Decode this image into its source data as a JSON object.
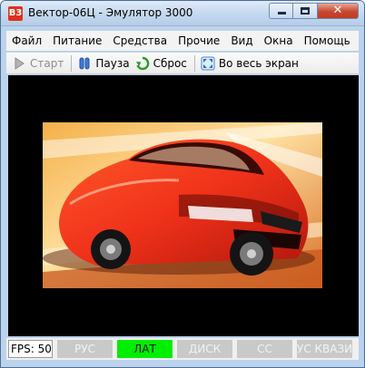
{
  "window": {
    "title": "Вектор-06Ц - Эмулятор 3000",
    "icon_glyph": "B3",
    "close_glyph": "✕"
  },
  "menu": [
    {
      "label": "Файл"
    },
    {
      "label": "Питание"
    },
    {
      "label": "Средства"
    },
    {
      "label": "Прочие"
    },
    {
      "label": "Вид"
    },
    {
      "label": "Окна"
    },
    {
      "label": "Помощь"
    }
  ],
  "toolbar": {
    "start_label": "Старт",
    "start_enabled": false,
    "pause_label": "Пауза",
    "reset_label": "Сброс",
    "fullscreen_label": "Во весь экран"
  },
  "screen": {
    "content": "red-sports-car-image"
  },
  "status": {
    "fps_text": "FPS: 50",
    "indicators": [
      {
        "label": "РУС",
        "active": false
      },
      {
        "label": "ЛАТ",
        "active": true
      },
      {
        "label": "ДИСК",
        "active": false
      },
      {
        "label": "СС",
        "active": false
      },
      {
        "label": "УС КВАЗИ",
        "active": false
      }
    ]
  },
  "colors": {
    "indicator_active": "#00ee00",
    "indicator_inactive": "#c9c9c9",
    "screen_background": "#000000",
    "close_button": "#c6482f"
  }
}
